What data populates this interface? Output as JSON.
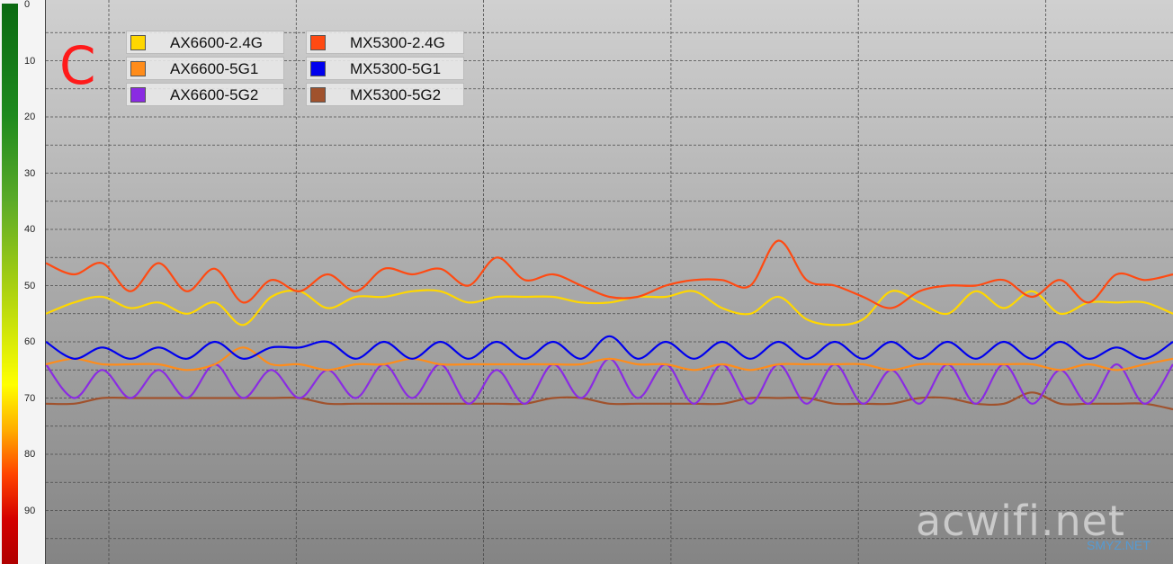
{
  "corner_mark": "C",
  "watermark": "acwifi.net",
  "watermark_small": "SMYZ.NET",
  "chart_data": {
    "type": "line",
    "title": "",
    "xlabel": "",
    "ylabel": "",
    "ylim": [
      0,
      100
    ],
    "y_inverted": true,
    "yticks": [
      "0",
      "10",
      "20",
      "30",
      "40",
      "50",
      "60",
      "70",
      "80",
      "90"
    ],
    "grid": true,
    "legend_position": "top-left",
    "colors": {
      "AX6600-2.4G": "#ffd700",
      "AX6600-5G1": "#ff8c1a",
      "AX6600-5G2": "#8a2be2",
      "MX5300-2.4G": "#ff4a12",
      "MX5300-5G1": "#0000ee",
      "MX5300-5G2": "#a0522d"
    },
    "series": [
      {
        "name": "AX6600-2.4G",
        "values": [
          55,
          53,
          52,
          54,
          53,
          55,
          53,
          57,
          52,
          51,
          54,
          52,
          52,
          51,
          51,
          53,
          52,
          52,
          52,
          53,
          53,
          52,
          52,
          51,
          54,
          55,
          52,
          56,
          57,
          56,
          51,
          53,
          55,
          51,
          54,
          51,
          55,
          53,
          53,
          53,
          55
        ]
      },
      {
        "name": "AX6600-5G1",
        "values": [
          64,
          63,
          64,
          64,
          64,
          65,
          64,
          61,
          64,
          64,
          65,
          64,
          64,
          63,
          64,
          64,
          64,
          64,
          64,
          64,
          63,
          64,
          64,
          65,
          64,
          65,
          64,
          64,
          64,
          64,
          65,
          64,
          64,
          64,
          64,
          64,
          65,
          64,
          65,
          64,
          63
        ]
      },
      {
        "name": "AX6600-5G2",
        "values": [
          64,
          70,
          65,
          70,
          65,
          70,
          64,
          70,
          65,
          70,
          65,
          70,
          64,
          70,
          64,
          71,
          65,
          71,
          64,
          70,
          63,
          70,
          64,
          71,
          64,
          71,
          64,
          71,
          64,
          71,
          65,
          71,
          64,
          71,
          64,
          71,
          65,
          71,
          64,
          71,
          64
        ]
      },
      {
        "name": "MX5300-2.4G",
        "values": [
          46,
          48,
          46,
          51,
          46,
          51,
          47,
          53,
          49,
          51,
          48,
          51,
          47,
          48,
          47,
          50,
          45,
          49,
          48,
          50,
          52,
          52,
          50,
          49,
          49,
          50,
          42,
          49,
          50,
          52,
          54,
          51,
          50,
          50,
          49,
          52,
          49,
          53,
          48,
          49,
          48
        ]
      },
      {
        "name": "MX5300-5G1",
        "values": [
          60,
          63,
          61,
          63,
          61,
          63,
          60,
          63,
          61,
          61,
          60,
          63,
          60,
          63,
          60,
          63,
          60,
          63,
          60,
          63,
          59,
          63,
          60,
          63,
          60,
          63,
          60,
          63,
          60,
          63,
          60,
          63,
          60,
          63,
          60,
          63,
          60,
          63,
          61,
          63,
          60
        ]
      },
      {
        "name": "MX5300-5G2",
        "values": [
          71,
          71,
          70,
          70,
          70,
          70,
          70,
          70,
          70,
          70,
          71,
          71,
          71,
          71,
          71,
          71,
          71,
          71,
          70,
          70,
          71,
          71,
          71,
          71,
          71,
          70,
          70,
          70,
          71,
          71,
          71,
          70,
          70,
          71,
          71,
          69,
          71,
          71,
          71,
          71,
          72
        ]
      }
    ]
  }
}
